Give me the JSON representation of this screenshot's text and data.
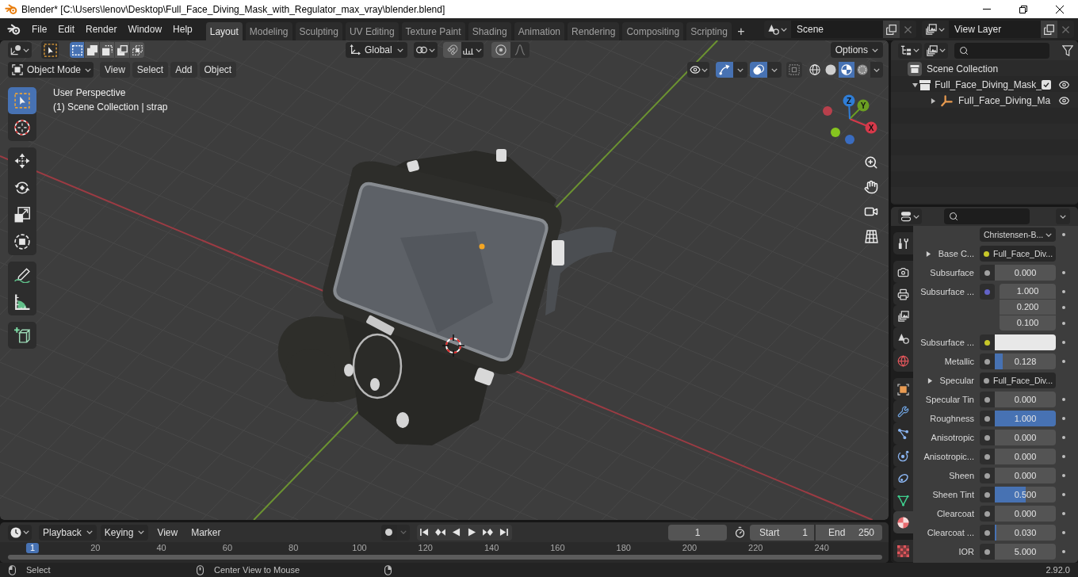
{
  "window": {
    "title": "Blender* [C:\\Users\\lenov\\Desktop\\Full_Face_Diving_Mask_with_Regulator_max_vray\\blender.blend]"
  },
  "menu": [
    "File",
    "Edit",
    "Render",
    "Window",
    "Help"
  ],
  "workspaces": [
    {
      "label": "Layout",
      "selected": true
    },
    {
      "label": "Modeling",
      "selected": false
    },
    {
      "label": "Sculpting",
      "selected": false
    },
    {
      "label": "UV Editing",
      "selected": false
    },
    {
      "label": "Texture Paint",
      "selected": false
    },
    {
      "label": "Shading",
      "selected": false
    },
    {
      "label": "Animation",
      "selected": false
    },
    {
      "label": "Rendering",
      "selected": false
    },
    {
      "label": "Compositing",
      "selected": false
    },
    {
      "label": "Scripting",
      "selected": false
    }
  ],
  "add_workspace": "+",
  "scene": {
    "name": "Scene"
  },
  "view_layer": {
    "name": "View Layer"
  },
  "tool_header": {
    "select_modes": [
      {
        "selected": true
      },
      {
        "selected": false
      },
      {
        "selected": false
      },
      {
        "selected": false
      },
      {
        "selected": false
      }
    ],
    "orientation": "Global",
    "snap_on": false,
    "proportional_on": false,
    "options": "Options"
  },
  "viewport": {
    "mode": "Object Mode",
    "menus": [
      "View",
      "Select",
      "Add",
      "Object"
    ],
    "gizmos_on": true,
    "overlays_on": true,
    "xray_on": false,
    "shading": [
      {
        "selected": false
      },
      {
        "selected": false
      },
      {
        "selected": true
      },
      {
        "selected": false
      }
    ],
    "info": [
      "User Perspective",
      "(1) Scene Collection | strap"
    ],
    "toolbar": [
      {
        "tools": [
          {
            "selected": true
          },
          {
            "selected": false
          }
        ]
      },
      {
        "tools": [
          {
            "selected": false
          },
          {
            "selected": false
          },
          {
            "selected": false
          },
          {
            "selected": false
          }
        ]
      },
      {
        "tools": [
          {
            "selected": false
          },
          {
            "selected": false
          }
        ]
      },
      {
        "tools": [
          {
            "selected": false
          }
        ]
      }
    ],
    "axes": [
      "X",
      "Y",
      "Z"
    ]
  },
  "outliner": {
    "items": [
      {
        "kind": "scene_collection",
        "label": "Scene Collection",
        "children": [
          {
            "kind": "collection",
            "label": "Full_Face_Diving_Mask_",
            "expanded": true,
            "checked": true,
            "visible": true,
            "children": [
              {
                "kind": "empty",
                "label": "Full_Face_Diving_Ma",
                "expanded": false,
                "visible": true
              }
            ]
          }
        ]
      }
    ]
  },
  "properties": {
    "tabs": [
      {
        "selected": false
      },
      {
        "selected": false
      },
      {
        "selected": false
      },
      {
        "selected": false
      },
      {
        "selected": false
      },
      {
        "selected": false
      },
      {
        "selected": false
      },
      {
        "selected": false
      },
      {
        "selected": false
      },
      {
        "selected": false
      },
      {
        "selected": false
      },
      {
        "selected": false
      },
      {
        "selected": true
      },
      {
        "selected": false
      }
    ],
    "rows": [
      {
        "kind": "dropdown",
        "value": "Christensen-B..."
      },
      {
        "kind": "link",
        "label": "Base C...",
        "expanded": false,
        "color": "#c7c729",
        "value": "Full_Face_Div..."
      },
      {
        "kind": "number",
        "label": "Subsurface",
        "color": "#a1a1a1",
        "value": "0.000"
      },
      {
        "kind": "vector",
        "label": "Subsurface ...",
        "color": "#6363c7",
        "values": [
          "1.000",
          "0.200",
          "0.100"
        ]
      },
      {
        "kind": "color",
        "label": "Subsurface ...",
        "color": "#c7c729",
        "swatch": {
          "color": "#e8e8e8"
        }
      },
      {
        "kind": "slider",
        "label": "Metallic",
        "color": "#a1a1a1",
        "value": "0.128",
        "level": 0.128
      },
      {
        "kind": "link",
        "label": "Specular",
        "expanded": false,
        "color": "#a1a1a1",
        "value": "Full_Face_Div..."
      },
      {
        "kind": "number",
        "label": "Specular Tin",
        "color": "#a1a1a1",
        "value": "0.000"
      },
      {
        "kind": "slider",
        "label": "Roughness",
        "color": "#a1a1a1",
        "value": "1.000",
        "level": 1
      },
      {
        "kind": "number",
        "label": "Anisotropic",
        "color": "#a1a1a1",
        "value": "0.000"
      },
      {
        "kind": "number",
        "label": "Anisotropic...",
        "color": "#a1a1a1",
        "value": "0.000"
      },
      {
        "kind": "number",
        "label": "Sheen",
        "color": "#a1a1a1",
        "value": "0.000"
      },
      {
        "kind": "slider",
        "label": "Sheen Tint",
        "color": "#a1a1a1",
        "value": "0.500",
        "level": 0.5
      },
      {
        "kind": "number",
        "label": "Clearcoat",
        "color": "#a1a1a1",
        "value": "0.000"
      },
      {
        "kind": "slider",
        "label": "Clearcoat ...",
        "color": "#a1a1a1",
        "value": "0.030",
        "level": 0.03
      },
      {
        "kind": "number",
        "label": "IOR",
        "color": "#a1a1a1",
        "value": "5.000"
      }
    ]
  },
  "timeline": {
    "menus": [
      {
        "kind": "dropdown",
        "label": "Playback"
      },
      {
        "kind": "dropdown",
        "label": "Keying"
      },
      {
        "kind": "menu",
        "label": "View"
      },
      {
        "kind": "menu",
        "label": "Marker"
      }
    ],
    "auto_key": false,
    "frame": "1",
    "start_label": "Start",
    "start": "1",
    "end_label": "End",
    "end": "250",
    "playhead": "1",
    "ruler": [
      "20",
      "40",
      "60",
      "80",
      "100",
      "120",
      "140",
      "160",
      "180",
      "200",
      "220",
      "240"
    ]
  },
  "status_bar": {
    "hints": [
      "Select",
      "Center View to Mouse"
    ],
    "version": "2.92.0"
  }
}
